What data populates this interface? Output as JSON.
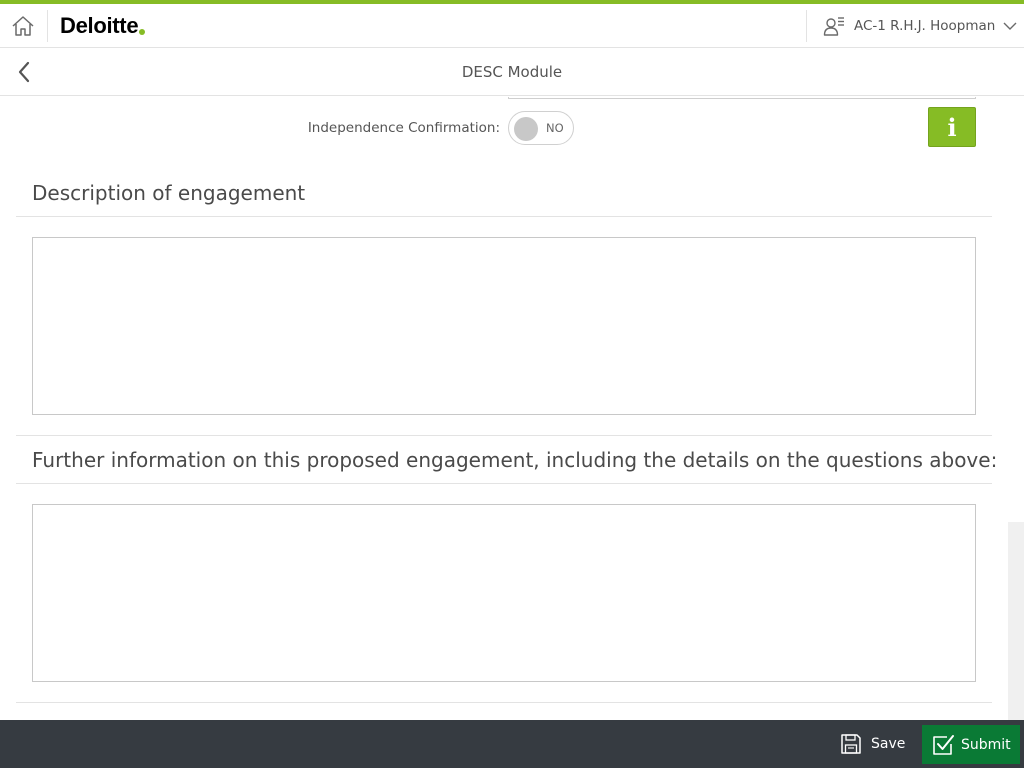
{
  "header": {
    "logo_text": "Deloitte",
    "user_name": "AC-1 R.H.J. Hoopman"
  },
  "titlebar": {
    "title": "DESC Module"
  },
  "form": {
    "independence_label": "Independence Confirmation:",
    "independence_toggle_value": "NO",
    "info_button_label": "i",
    "description_title": "Description of engagement",
    "description_value": "",
    "further_info_title": "Further information on this proposed engagement, including the details on the questions above:",
    "further_info_value": ""
  },
  "footer": {
    "save_label": "Save",
    "submit_label": "Submit"
  },
  "colors": {
    "brand_green": "#86bc25",
    "submit_green": "#0a7a35",
    "footer_bg": "#363b41"
  }
}
